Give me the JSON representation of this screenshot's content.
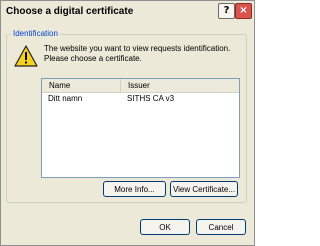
{
  "window": {
    "title": "Choose a digital certificate",
    "help_glyph": "?",
    "close_glyph": "×"
  },
  "group": {
    "label": "Identification"
  },
  "message": {
    "line1": "The website you want to view requests identification.",
    "line2": "Please choose a certificate."
  },
  "list": {
    "columns": [
      "Name",
      "Issuer"
    ],
    "rows": [
      {
        "name": "Ditt namn",
        "issuer": "SITHS CA v3"
      }
    ]
  },
  "buttons": {
    "more_info": "More Info...",
    "view_certificate": "View Certificate...",
    "ok": "OK",
    "cancel": "Cancel"
  }
}
